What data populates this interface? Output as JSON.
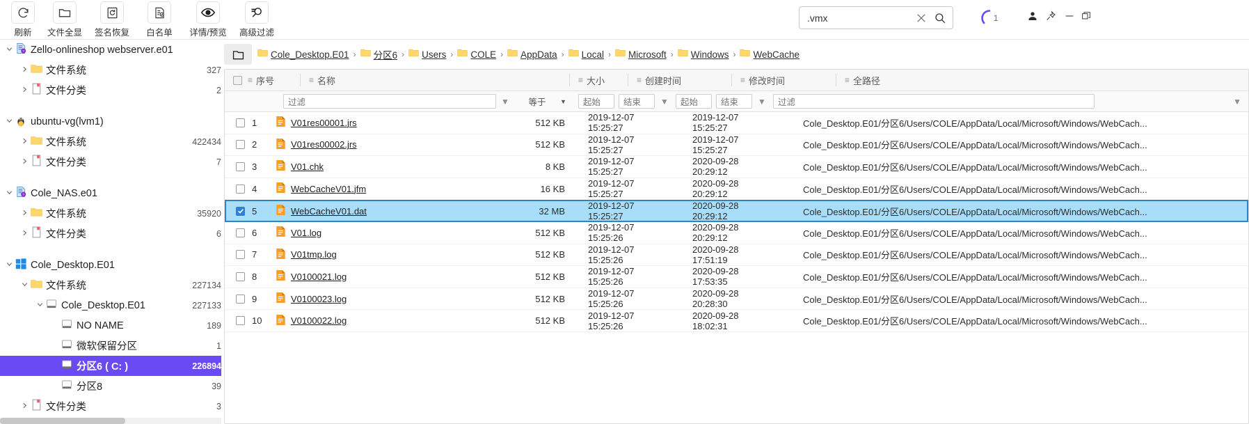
{
  "toolbar": {
    "items": [
      {
        "label": "刷新",
        "icon": "refresh-icon"
      },
      {
        "label": "文件全显",
        "icon": "folder-icon"
      },
      {
        "label": "签名恢复",
        "icon": "signature-recover-icon"
      },
      {
        "label": "白名单",
        "icon": "whitelist-document-icon"
      },
      {
        "label": "详情/预览",
        "icon": "eye-icon"
      },
      {
        "label": "高级过滤",
        "icon": "advanced-filter-icon"
      }
    ]
  },
  "search": {
    "value": ".vmx",
    "placeholder": "",
    "clear_icon": "close-icon",
    "search_icon": "search-icon"
  },
  "status": {
    "spinner_count": "1",
    "spinner_color": "#6a4af3"
  },
  "window_controls": {
    "user_icon": "user-icon",
    "pin_icon": "pin-icon",
    "minimize_icon": "minimize-icon",
    "maximize_icon": "maximize-icon"
  },
  "sidebar": {
    "nodes": [
      {
        "label": "Zello-onlineshop webserver.e01",
        "icon": "evidence-image-icon",
        "indent": 0,
        "expanded": true,
        "count": "",
        "selected": false
      },
      {
        "label": "文件系统",
        "icon": "folder-icon",
        "indent": 1,
        "expanded": false,
        "count": "327",
        "selected": false
      },
      {
        "label": "文件分类",
        "icon": "classification-icon",
        "indent": 1,
        "expanded": false,
        "count": "2",
        "selected": false
      },
      {
        "label": "__GAP__",
        "icon": "",
        "indent": 0,
        "expanded": false,
        "count": "",
        "selected": false
      },
      {
        "label": "ubuntu-vg(lvm1)",
        "icon": "linux-icon",
        "indent": 0,
        "expanded": true,
        "count": "",
        "selected": false
      },
      {
        "label": "文件系统",
        "icon": "folder-icon",
        "indent": 1,
        "expanded": false,
        "count": "422434",
        "selected": false
      },
      {
        "label": "文件分类",
        "icon": "classification-icon",
        "indent": 1,
        "expanded": false,
        "count": "7",
        "selected": false
      },
      {
        "label": "__GAP__",
        "icon": "",
        "indent": 0,
        "expanded": false,
        "count": "",
        "selected": false
      },
      {
        "label": "Cole_NAS.e01",
        "icon": "evidence-image-icon",
        "indent": 0,
        "expanded": true,
        "count": "",
        "selected": false
      },
      {
        "label": "文件系统",
        "icon": "folder-icon",
        "indent": 1,
        "expanded": false,
        "count": "35920",
        "selected": false
      },
      {
        "label": "文件分类",
        "icon": "classification-icon",
        "indent": 1,
        "expanded": false,
        "count": "6",
        "selected": false
      },
      {
        "label": "__GAP__",
        "icon": "",
        "indent": 0,
        "expanded": false,
        "count": "",
        "selected": false
      },
      {
        "label": "Cole_Desktop.E01",
        "icon": "windows-icon",
        "indent": 0,
        "expanded": true,
        "count": "",
        "selected": false
      },
      {
        "label": "文件系统",
        "icon": "folder-icon",
        "indent": 1,
        "expanded": true,
        "count": "227134",
        "selected": false
      },
      {
        "label": "Cole_Desktop.E01",
        "icon": "disk-icon",
        "indent": 2,
        "expanded": true,
        "count": "227133",
        "selected": false
      },
      {
        "label": "NO NAME",
        "icon": "disk-icon",
        "indent": 3,
        "expanded": null,
        "count": "189",
        "selected": false
      },
      {
        "label": "微软保留分区",
        "icon": "disk-icon",
        "indent": 3,
        "expanded": null,
        "count": "1",
        "selected": false
      },
      {
        "label": "分区6 ( C: )",
        "icon": "disk-icon",
        "indent": 3,
        "expanded": null,
        "count": "226894",
        "selected": true
      },
      {
        "label": "分区8",
        "icon": "disk-icon",
        "indent": 3,
        "expanded": null,
        "count": "39",
        "selected": false
      },
      {
        "label": "文件分类",
        "icon": "classification-icon",
        "indent": 1,
        "expanded": false,
        "count": "3",
        "selected": false
      }
    ]
  },
  "breadcrumb": {
    "home_icon": "folder-home-icon",
    "items": [
      "Cole_Desktop.E01",
      "分区6",
      "Users",
      "COLE",
      "AppData",
      "Local",
      "Microsoft",
      "Windows",
      "WebCache"
    ],
    "separator": "›"
  },
  "table": {
    "columns": [
      {
        "key": "idx",
        "label": "序号",
        "icon": "column-menu-icon"
      },
      {
        "key": "name",
        "label": "名称",
        "icon": "column-menu-icon"
      },
      {
        "key": "size",
        "label": "大小",
        "icon": "column-menu-icon"
      },
      {
        "key": "ct",
        "label": "创建时间",
        "icon": "column-menu-icon"
      },
      {
        "key": "mt",
        "label": "修改时间",
        "icon": "column-menu-icon"
      },
      {
        "key": "path",
        "label": "全路径",
        "icon": "column-menu-icon"
      }
    ],
    "filters": {
      "name_placeholder": "过滤",
      "size_operator": "等于",
      "ct_start": "起始",
      "ct_end": "结束",
      "mt_start": "起始",
      "mt_end": "结束",
      "path_placeholder": "过滤",
      "funnel_icon": "funnel-icon",
      "chevron_icon": "chevron-down-icon"
    },
    "rows": [
      {
        "idx": "1",
        "name": "V01res00001.jrs",
        "size": "512 KB",
        "ct": "2019-12-07 15:25:27",
        "mt": "2019-12-07 15:25:27",
        "path": "Cole_Desktop.E01/分区6/Users/COLE/AppData/Local/Microsoft/Windows/WebCach...",
        "checked": false,
        "selected": false
      },
      {
        "idx": "2",
        "name": "V01res00002.jrs",
        "size": "512 KB",
        "ct": "2019-12-07 15:25:27",
        "mt": "2019-12-07 15:25:27",
        "path": "Cole_Desktop.E01/分区6/Users/COLE/AppData/Local/Microsoft/Windows/WebCach...",
        "checked": false,
        "selected": false
      },
      {
        "idx": "3",
        "name": "V01.chk",
        "size": "8 KB",
        "ct": "2019-12-07 15:25:27",
        "mt": "2020-09-28 20:29:12",
        "path": "Cole_Desktop.E01/分区6/Users/COLE/AppData/Local/Microsoft/Windows/WebCach...",
        "checked": false,
        "selected": false
      },
      {
        "idx": "4",
        "name": "WebCacheV01.jfm",
        "size": "16 KB",
        "ct": "2019-12-07 15:25:27",
        "mt": "2020-09-28 20:29:12",
        "path": "Cole_Desktop.E01/分区6/Users/COLE/AppData/Local/Microsoft/Windows/WebCach...",
        "checked": false,
        "selected": false
      },
      {
        "idx": "5",
        "name": "WebCacheV01.dat",
        "size": "32 MB",
        "ct": "2019-12-07 15:25:27",
        "mt": "2020-09-28 20:29:12",
        "path": "Cole_Desktop.E01/分区6/Users/COLE/AppData/Local/Microsoft/Windows/WebCach...",
        "checked": true,
        "selected": true
      },
      {
        "idx": "6",
        "name": "V01.log",
        "size": "512 KB",
        "ct": "2019-12-07 15:25:26",
        "mt": "2020-09-28 20:29:12",
        "path": "Cole_Desktop.E01/分区6/Users/COLE/AppData/Local/Microsoft/Windows/WebCach...",
        "checked": false,
        "selected": false
      },
      {
        "idx": "7",
        "name": "V01tmp.log",
        "size": "512 KB",
        "ct": "2019-12-07 15:25:26",
        "mt": "2020-09-28 17:51:19",
        "path": "Cole_Desktop.E01/分区6/Users/COLE/AppData/Local/Microsoft/Windows/WebCach...",
        "checked": false,
        "selected": false
      },
      {
        "idx": "8",
        "name": "V0100021.log",
        "size": "512 KB",
        "ct": "2019-12-07 15:25:26",
        "mt": "2020-09-28 17:53:35",
        "path": "Cole_Desktop.E01/分区6/Users/COLE/AppData/Local/Microsoft/Windows/WebCach...",
        "checked": false,
        "selected": false
      },
      {
        "idx": "9",
        "name": "V0100023.log",
        "size": "512 KB",
        "ct": "2019-12-07 15:25:26",
        "mt": "2020-09-28 20:28:30",
        "path": "Cole_Desktop.E01/分区6/Users/COLE/AppData/Local/Microsoft/Windows/WebCach...",
        "checked": false,
        "selected": false
      },
      {
        "idx": "10",
        "name": "V0100022.log",
        "size": "512 KB",
        "ct": "2019-12-07 15:25:26",
        "mt": "2020-09-28 18:02:31",
        "path": "Cole_Desktop.E01/分区6/Users/COLE/AppData/Local/Microsoft/Windows/WebCach...",
        "checked": false,
        "selected": false
      }
    ],
    "file_icon": "file-orange-icon",
    "selection_color": "#a9defa"
  }
}
